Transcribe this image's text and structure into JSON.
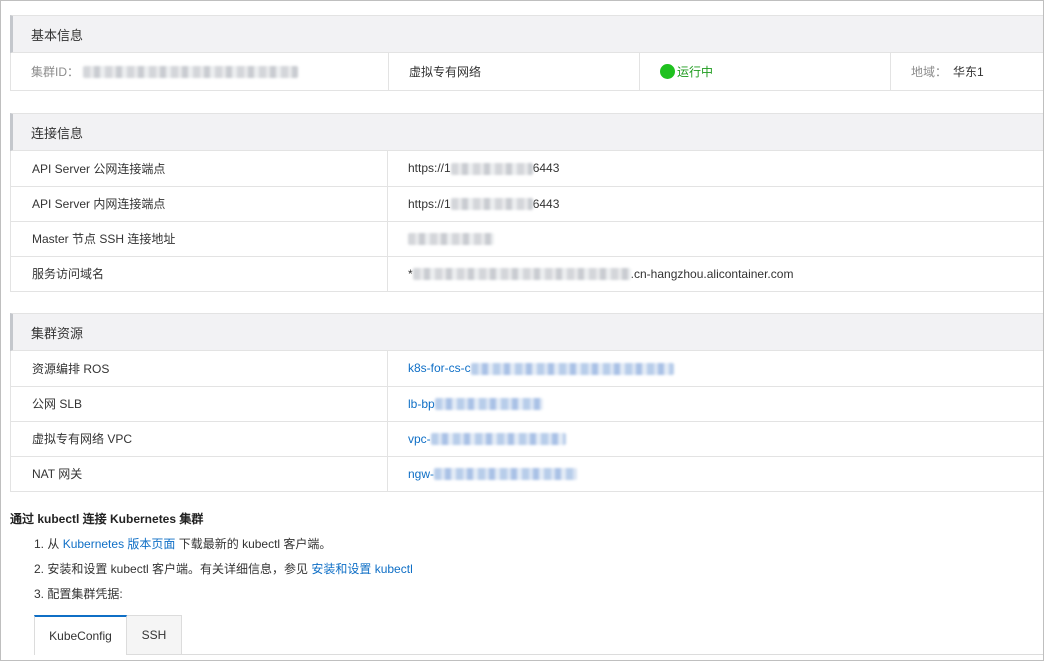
{
  "basic": {
    "title": "基本信息",
    "cluster_id_label": "集群ID：",
    "network_type": "虚拟专有网络",
    "status": "运行中",
    "region_label": "地域：",
    "region_value": "华东1"
  },
  "connection": {
    "title": "连接信息",
    "rows": [
      {
        "key": "API Server 公网连接端点",
        "prefix": "https://1",
        "suffix": "6443"
      },
      {
        "key": "API Server 内网连接端点",
        "prefix": "https://1",
        "suffix": "6443"
      },
      {
        "key": "Master 节点 SSH 连接地址",
        "prefix": "",
        "suffix": ""
      },
      {
        "key": "服务访问域名",
        "prefix": "*",
        "suffix": ".cn-hangzhou.alicontainer.com"
      }
    ]
  },
  "resources": {
    "title": "集群资源",
    "rows": [
      {
        "key": "资源编排 ROS",
        "prefix": "k8s-for-cs-c"
      },
      {
        "key": "公网 SLB",
        "prefix": "lb-bp"
      },
      {
        "key": "虚拟专有网络 VPC",
        "prefix": "vpc-"
      },
      {
        "key": "NAT 网关",
        "prefix": "ngw-"
      }
    ]
  },
  "guide": {
    "title": "通过 kubectl 连接 Kubernetes 集群",
    "step1_a": "1. 从 ",
    "step1_link": "Kubernetes 版本页面",
    "step1_b": " 下载最新的 kubectl 客户端。",
    "step2_a": "2. 安装和设置 kubectl 客户端。有关详细信息，参见 ",
    "step2_link": "安装和设置 kubectl",
    "step3": "3. 配置集群凭据:",
    "tabs": [
      "KubeConfig",
      "SSH"
    ]
  },
  "colors": {
    "link": "#0f6fc6",
    "status_green": "#1fc11f",
    "tab_accent": "#0f6fc6"
  }
}
